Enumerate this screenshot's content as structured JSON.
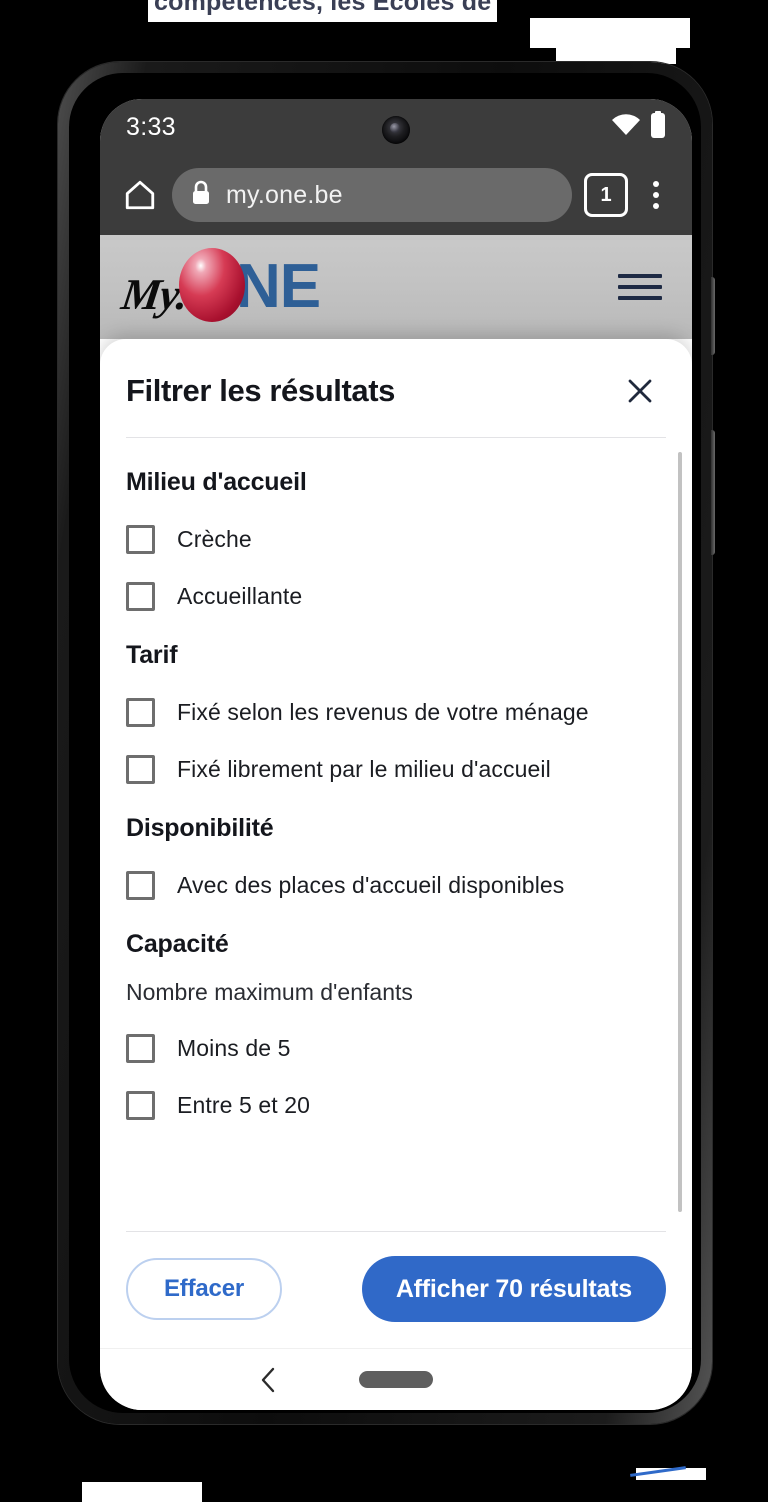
{
  "background": {
    "clipped_text": "compétences, les Écoles de "
  },
  "phone": {
    "status_bar": {
      "time": "3:33",
      "wifi_icon": "wifi-icon",
      "battery_icon": "battery-full-icon"
    },
    "browser": {
      "home_icon": "home-icon",
      "lock_icon": "lock-icon",
      "url": "my.one.be",
      "tab_count": "1",
      "overflow_icon": "more-vertical-icon"
    },
    "nav_bar": {
      "back_icon": "chevron-left-icon",
      "home_indicator": "home-indicator"
    }
  },
  "site_header": {
    "logo": {
      "my": "My.",
      "ne": "NE",
      "ball_color": "#c0203f",
      "ne_color": "#2e5f96"
    },
    "menu_icon": "hamburger-menu-icon"
  },
  "modal": {
    "title": "Filtrer les résultats",
    "close_icon": "close-icon",
    "groups": [
      {
        "title": "Milieu d'accueil",
        "subtitle": null,
        "options": [
          {
            "label": "Crèche",
            "checked": false
          },
          {
            "label": "Accueillante",
            "checked": false
          }
        ]
      },
      {
        "title": "Tarif",
        "subtitle": null,
        "options": [
          {
            "label": "Fixé selon les revenus de votre ménage",
            "checked": false
          },
          {
            "label": "Fixé librement par le milieu d'accueil",
            "checked": false
          }
        ]
      },
      {
        "title": "Disponibilité",
        "subtitle": null,
        "options": [
          {
            "label": "Avec des places d'accueil disponibles",
            "checked": false
          }
        ]
      },
      {
        "title": "Capacité",
        "subtitle": "Nombre maximum d'enfants",
        "options": [
          {
            "label": "Moins de 5",
            "checked": false
          },
          {
            "label": "Entre 5 et 20",
            "checked": false
          }
        ]
      }
    ],
    "actions": {
      "clear_label": "Effacer",
      "apply_label": "Afficher 70 résultats",
      "result_count": 70
    },
    "colors": {
      "primary": "#3069c8",
      "primary_outline": "#bcd0ef",
      "text": "#14161c",
      "checkbox_border": "#6e6e6e"
    }
  }
}
